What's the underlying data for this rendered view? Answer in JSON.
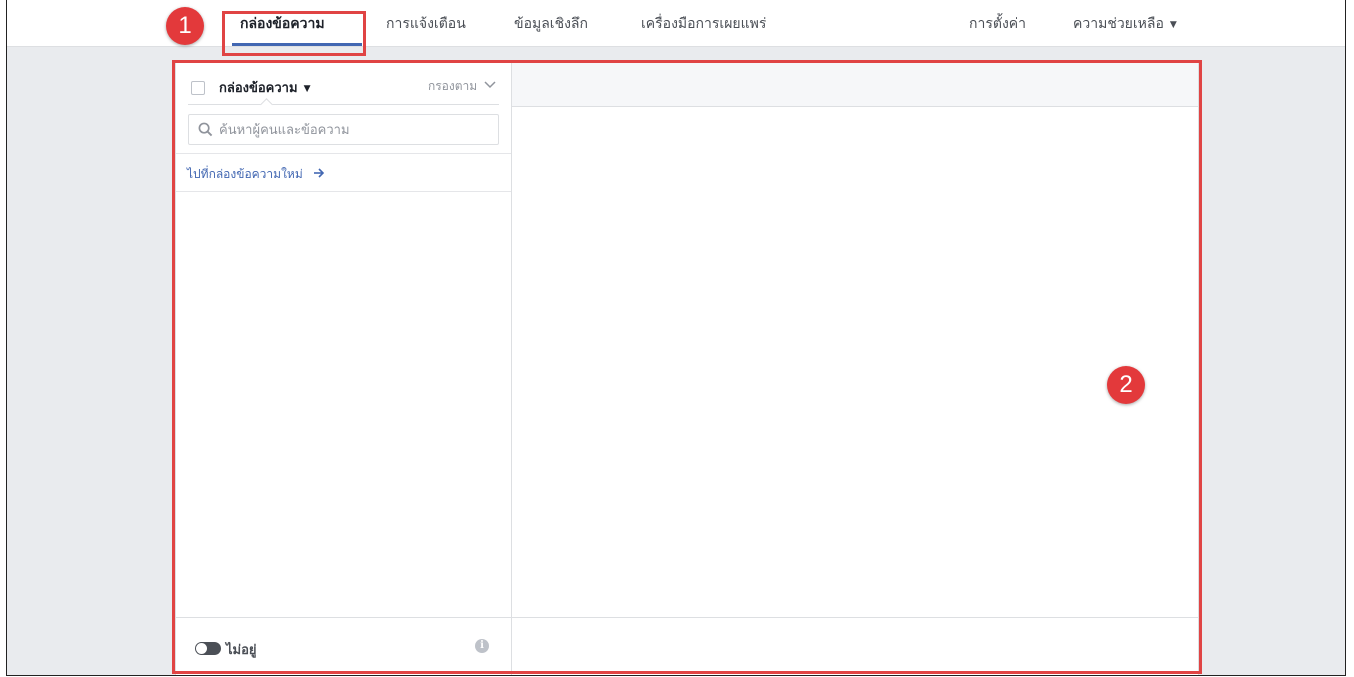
{
  "nav": {
    "inbox": "กล่องข้อความ",
    "notifications": "การแจ้งเตือน",
    "insights": "ข้อมูลเชิงลึก",
    "publishing_tools": "เครื่องมือการเผยแพร่",
    "settings": "การตั้งค่า",
    "help": "ความช่วยเหลือ"
  },
  "inbox": {
    "title": "กล่องข้อความ",
    "filter_label": "กรองตาม",
    "search_placeholder": "ค้นหาผู้คนและข้อความ",
    "new_inbox_link": "ไปที่กล่องข้อความใหม่",
    "away_label": "ไม่อยู่"
  },
  "annotations": {
    "badge_1": "1",
    "badge_2": "2"
  },
  "colors": {
    "accent": "#4267b2",
    "highlight": "#e04444",
    "badge": "#e3393b"
  },
  "icons": [
    "search-icon",
    "chevron-down-icon",
    "arrow-right-icon",
    "info-icon",
    "toggle-icon"
  ]
}
